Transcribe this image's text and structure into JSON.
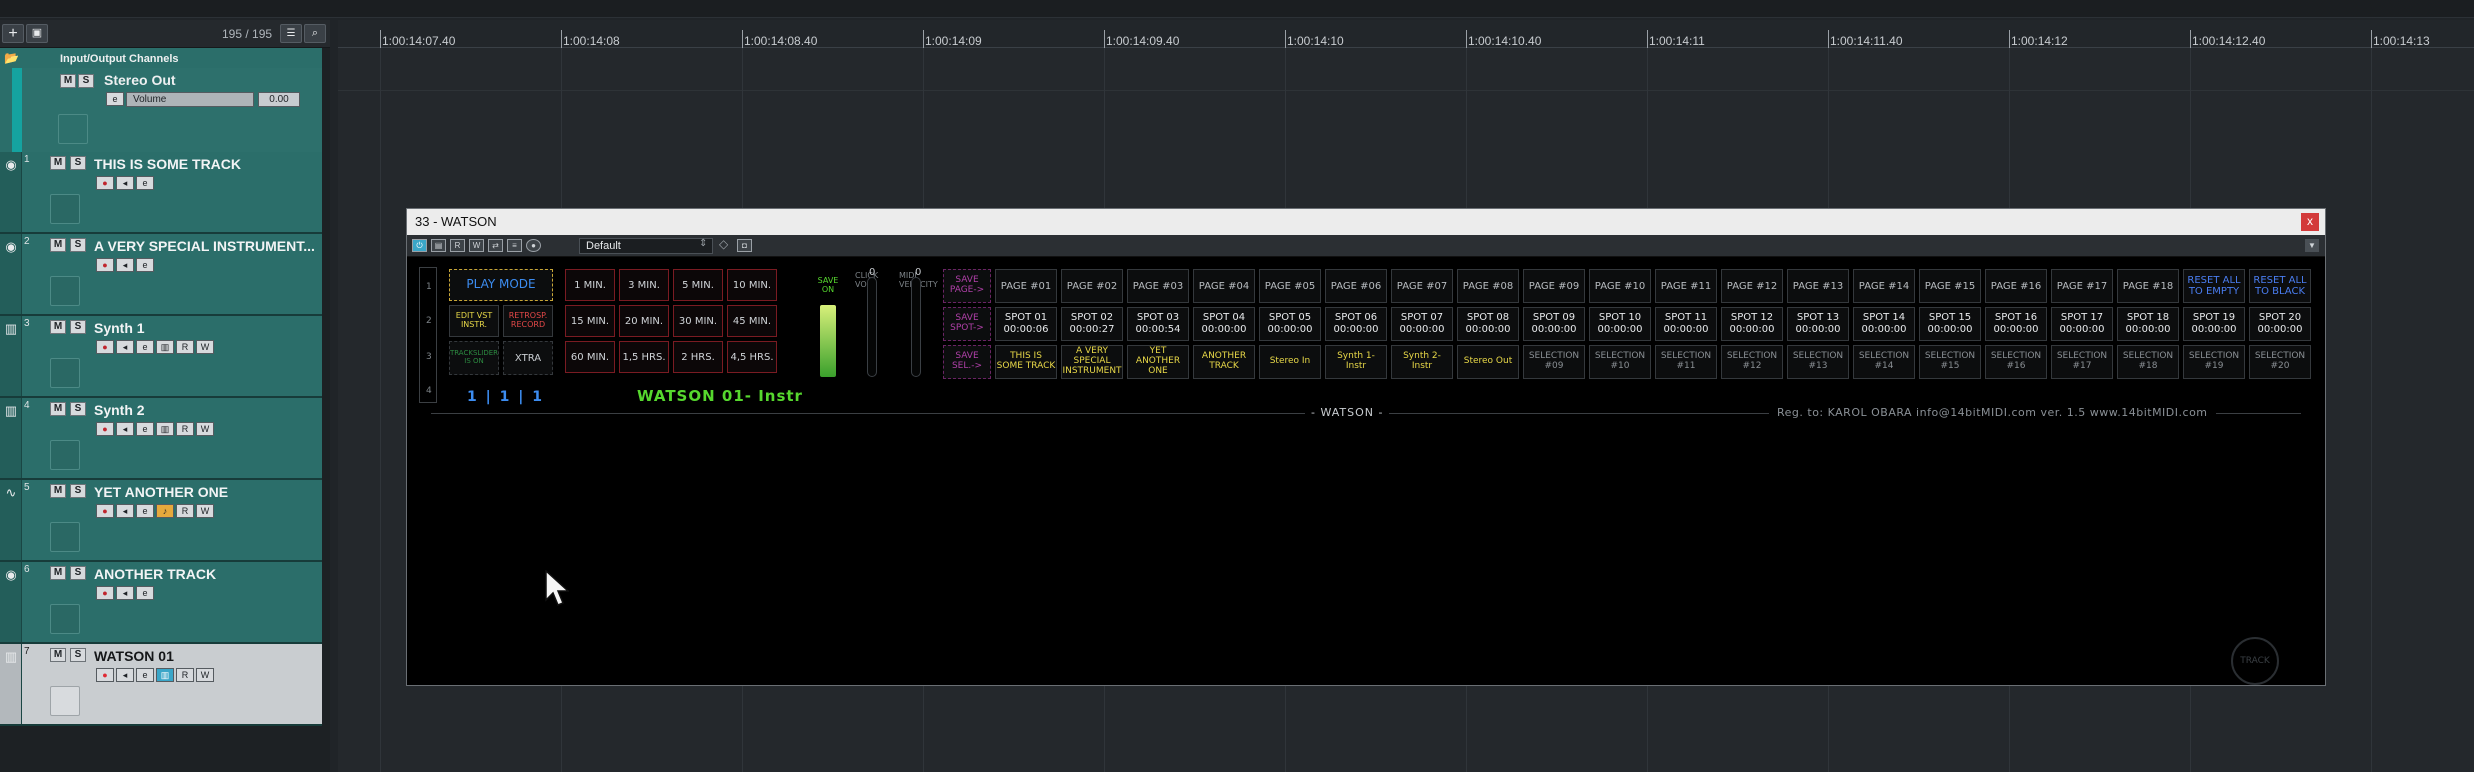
{
  "toolbar": {
    "add_icon": "plus-icon",
    "folder_icon": "folder-add-icon",
    "track_count": "195 / 195"
  },
  "ruler": {
    "labels": [
      "1:00:14:07.40",
      "1:00:14:08",
      "1:00:14:08.40",
      "1:00:14:09",
      "1:00:14:09.40",
      "1:00:14:10",
      "1:00:14:10.40",
      "1:00:14:11",
      "1:00:14:11.40",
      "1:00:14:12",
      "1:00:14:12.40",
      "1:00:14:13"
    ]
  },
  "io": {
    "folder": "Input/Output Channels",
    "name": "Stereo Out",
    "volume_label": "Volume",
    "volume_value": "0.00"
  },
  "tracks": [
    {
      "num": "1",
      "name": "THIS IS SOME TRACK",
      "icon": "audio-icon"
    },
    {
      "num": "2",
      "name": "A VERY SPECIAL INSTRUMENT...",
      "icon": "audio-icon"
    },
    {
      "num": "3",
      "name": "Synth 1",
      "icon": "keyboard-icon"
    },
    {
      "num": "4",
      "name": "Synth 2",
      "icon": "keyboard-icon"
    },
    {
      "num": "5",
      "name": "YET ANOTHER ONE",
      "icon": "fx-icon"
    },
    {
      "num": "6",
      "name": "ANOTHER TRACK",
      "icon": "audio-icon"
    },
    {
      "num": "7",
      "name": "WATSON 01",
      "icon": "keyboard-icon"
    }
  ],
  "track_buttons": {
    "mute": "M",
    "solo": "S",
    "read": "R",
    "write": "W"
  },
  "plugin": {
    "title": "33 - WATSON",
    "close": "x",
    "preset": "Default",
    "toolbar_labels": [
      "",
      "",
      "R",
      "W",
      ""
    ],
    "row_nums": [
      "1",
      "2",
      "3",
      "4"
    ],
    "play_mode": "PLAY MODE",
    "edit_vst": "EDIT VST INSTR.",
    "retrospect": "RETROSP. RECORD",
    "trackslider": "TRACKSLIDER IS ON",
    "xtra": "XTRA",
    "times": [
      "1 MIN.",
      "3 MIN.",
      "5 MIN.",
      "10 MIN.",
      "15 MIN.",
      "20 MIN.",
      "30 MIN.",
      "45 MIN.",
      "60 MIN.",
      "1,5 HRS.",
      "2 HRS.",
      "4,5 HRS."
    ],
    "counter": "1 | 1 | 1",
    "instr_name": "WATSON 01- Instr",
    "save_on": "SAVE ON",
    "click_vol": "CLICK VOL",
    "midi_velocity": "MIDI VELOCITY",
    "vol_val": "0",
    "vel_val": "0",
    "save_page": "SAVE PAGE->",
    "save_spot": "SAVE SPOT->",
    "save_sel": "SAVE SEL.->",
    "pages": [
      "PAGE #01",
      "PAGE #02",
      "PAGE #03",
      "PAGE #04",
      "PAGE #05",
      "PAGE #06",
      "PAGE #07",
      "PAGE #08",
      "PAGE #09",
      "PAGE #10",
      "PAGE #11",
      "PAGE #12",
      "PAGE #13",
      "PAGE #14",
      "PAGE #15",
      "PAGE #16",
      "PAGE #17",
      "PAGE #18"
    ],
    "reset_empty": "RESET ALL TO EMPTY",
    "reset_black": "RESET ALL TO BLACK",
    "spots": [
      {
        "n": "SPOT 01",
        "t": "00:00:06"
      },
      {
        "n": "SPOT 02",
        "t": "00:00:27"
      },
      {
        "n": "SPOT 03",
        "t": "00:00:54"
      },
      {
        "n": "SPOT 04",
        "t": "00:00:00"
      },
      {
        "n": "SPOT 05",
        "t": "00:00:00"
      },
      {
        "n": "SPOT 06",
        "t": "00:00:00"
      },
      {
        "n": "SPOT 07",
        "t": "00:00:00"
      },
      {
        "n": "SPOT 08",
        "t": "00:00:00"
      },
      {
        "n": "SPOT 09",
        "t": "00:00:00"
      },
      {
        "n": "SPOT 10",
        "t": "00:00:00"
      },
      {
        "n": "SPOT 11",
        "t": "00:00:00"
      },
      {
        "n": "SPOT 12",
        "t": "00:00:00"
      },
      {
        "n": "SPOT 13",
        "t": "00:00:00"
      },
      {
        "n": "SPOT 14",
        "t": "00:00:00"
      },
      {
        "n": "SPOT 15",
        "t": "00:00:00"
      },
      {
        "n": "SPOT 16",
        "t": "00:00:00"
      },
      {
        "n": "SPOT 17",
        "t": "00:00:00"
      },
      {
        "n": "SPOT 18",
        "t": "00:00:00"
      },
      {
        "n": "SPOT 19",
        "t": "00:00:00"
      },
      {
        "n": "SPOT 20",
        "t": "00:00:00"
      }
    ],
    "selections": [
      "THIS IS SOME TRACK",
      "A VERY SPECIAL INSTRUMENT",
      "YET ANOTHER ONE",
      "ANOTHER TRACK",
      "Stereo In",
      "Synth 1- Instr",
      "Synth 2- Instr",
      "Stereo Out",
      "SELECTION #09",
      "SELECTION #10",
      "SELECTION #11",
      "SELECTION #12",
      "SELECTION #13",
      "SELECTION #14",
      "SELECTION #15",
      "SELECTION #16",
      "SELECTION #17",
      "SELECTION #18",
      "SELECTION #19",
      "SELECTION #20"
    ],
    "brand_tag": "- WATSON -",
    "reg_line": "Reg. to: KAROL OBARA    info@14bitMIDI.com    ver. 1.5    www.14bitMIDI.com",
    "logo_text": "TRACK"
  },
  "colors": {
    "track_teal": "#2b6e6a",
    "selected_track": "#c9cdd0",
    "watson_green": "#56d82e",
    "watson_blue": "#3c8cf0"
  }
}
